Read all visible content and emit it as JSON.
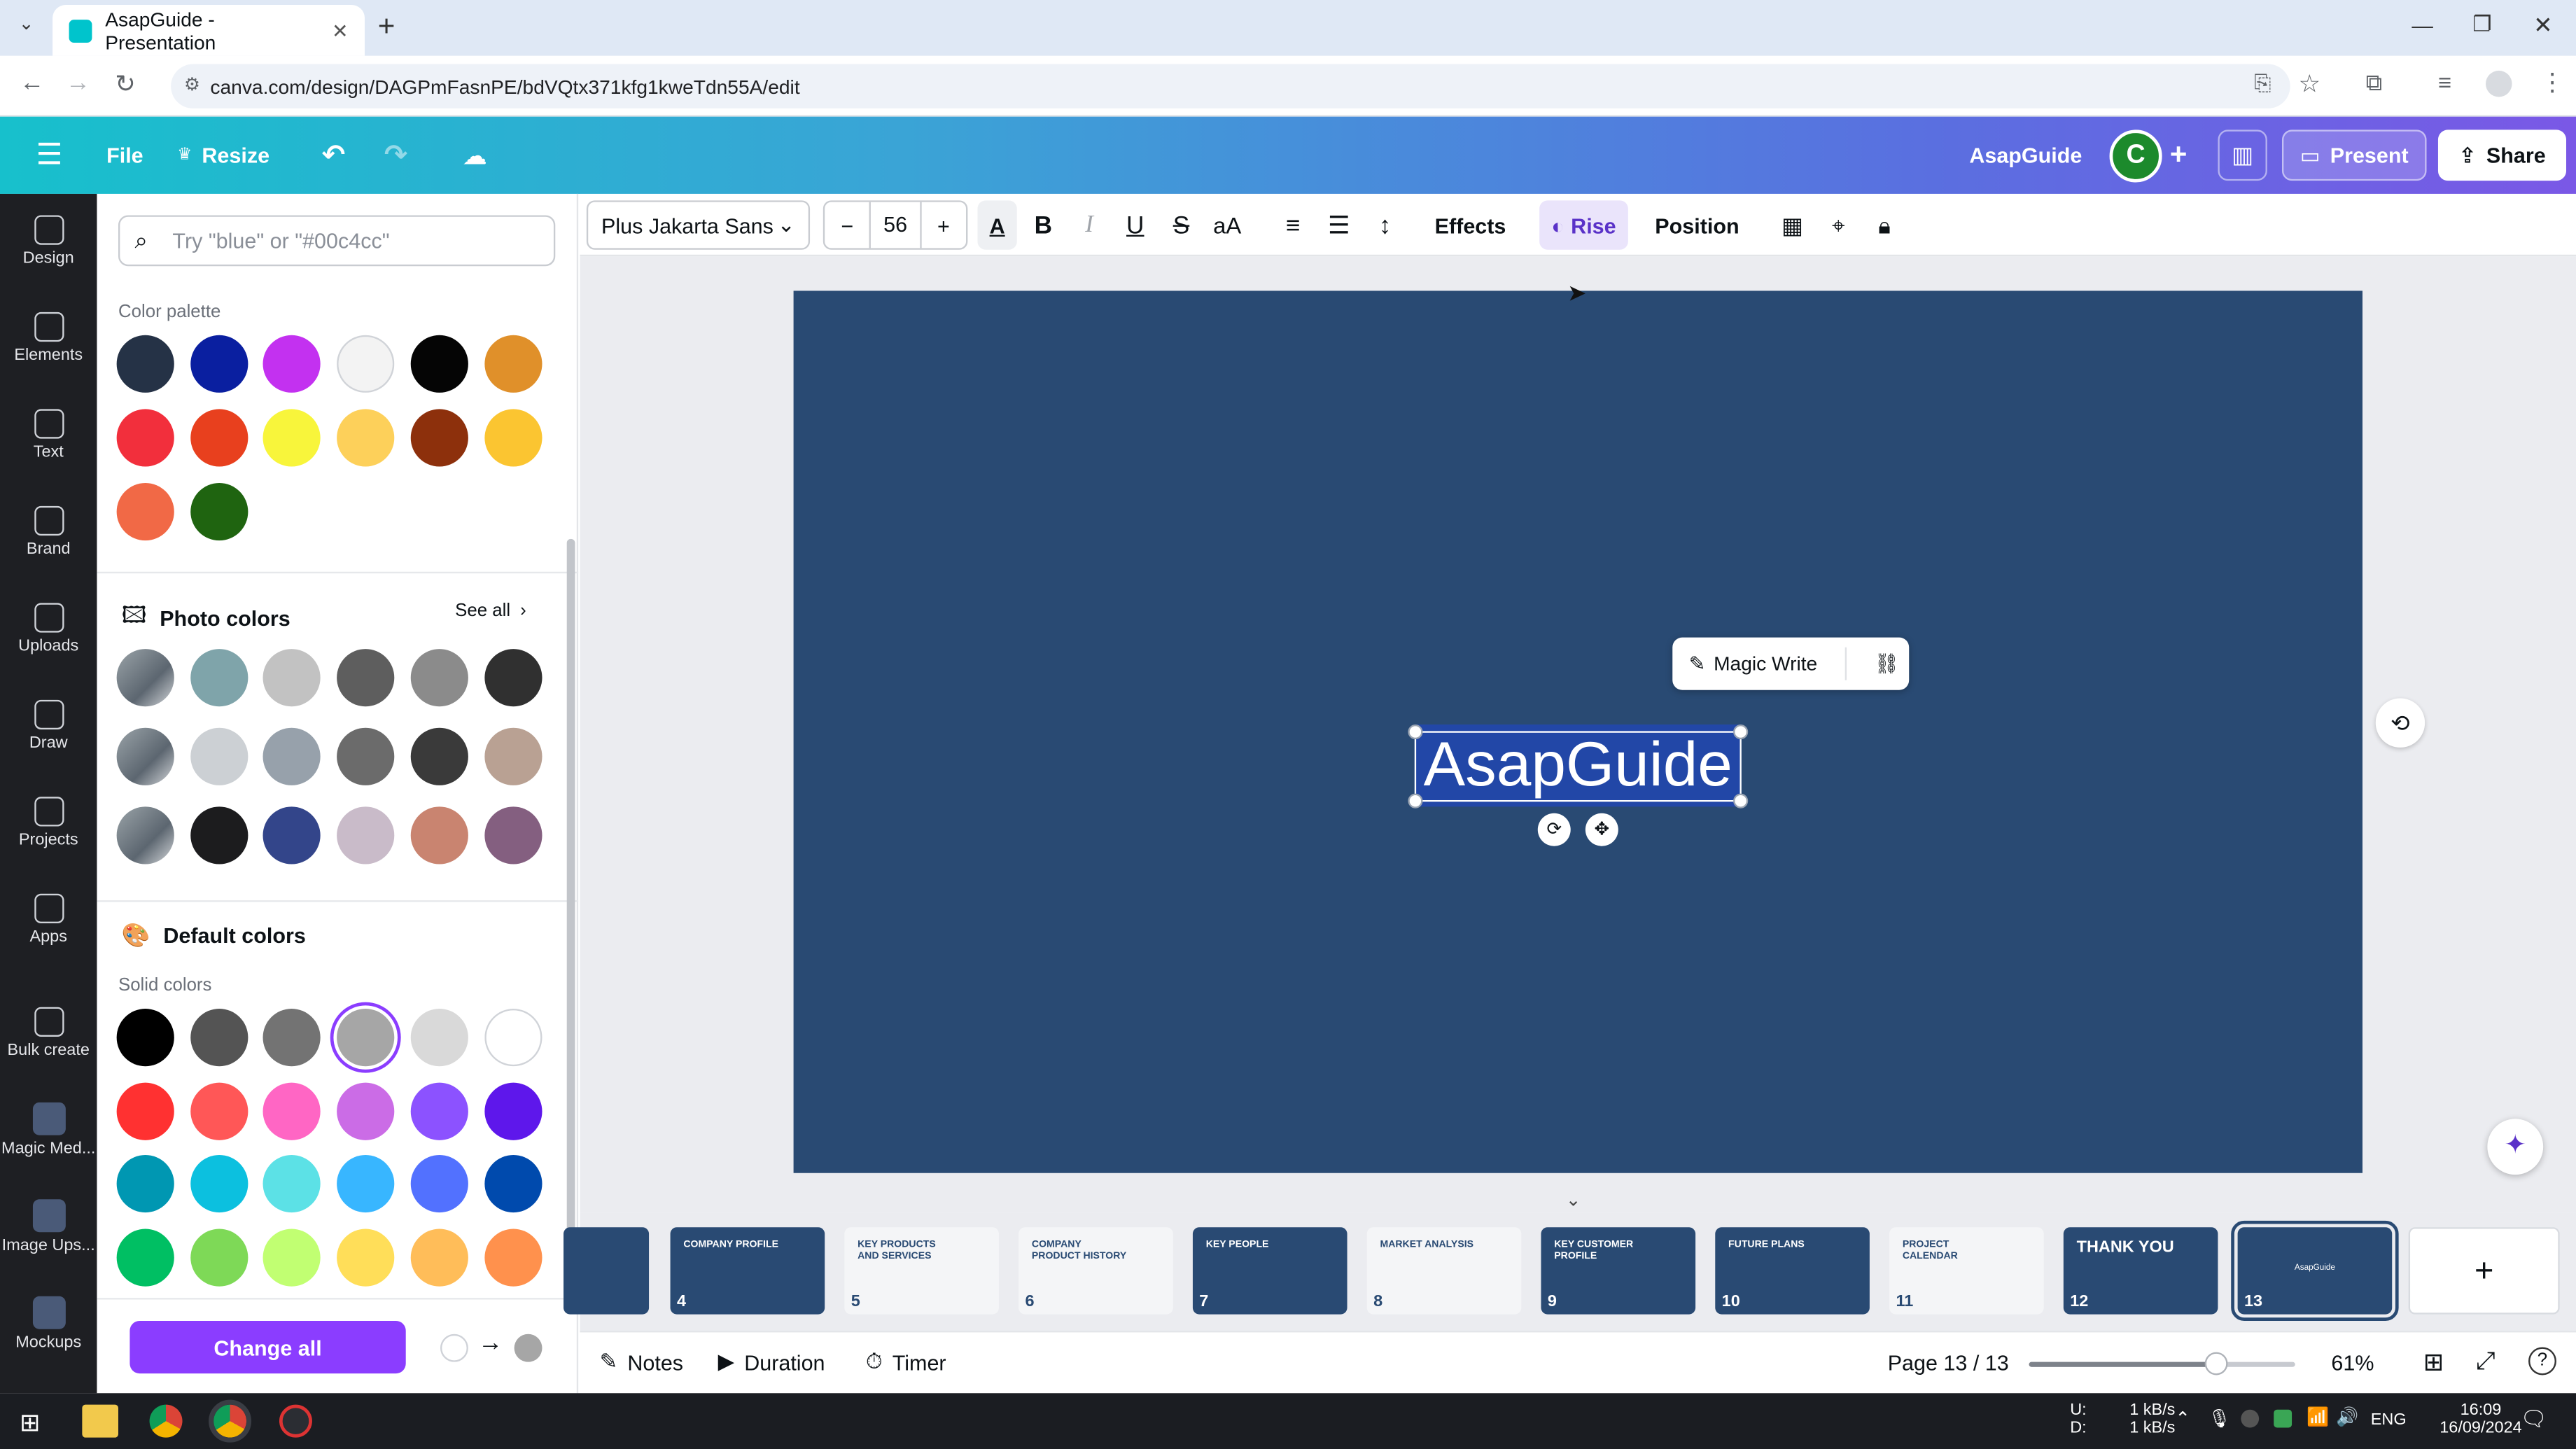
{
  "browser": {
    "tab_title": "AsapGuide - Presentation",
    "url": "canva.com/design/DAGPmFasnPE/bdVQtx371kfg1kweTdn55A/edit"
  },
  "header": {
    "file": "File",
    "resize": "Resize",
    "project_name": "AsapGuide",
    "avatar_initial": "C",
    "present": "Present",
    "share": "Share"
  },
  "rail": [
    {
      "label": "Design",
      "icon": "design-icon"
    },
    {
      "label": "Elements",
      "icon": "elements-icon"
    },
    {
      "label": "Text",
      "icon": "text-icon"
    },
    {
      "label": "Brand",
      "icon": "brand-icon"
    },
    {
      "label": "Uploads",
      "icon": "uploads-icon"
    },
    {
      "label": "Draw",
      "icon": "draw-icon"
    },
    {
      "label": "Projects",
      "icon": "projects-icon"
    },
    {
      "label": "Apps",
      "icon": "apps-icon"
    },
    {
      "label": "Bulk create",
      "icon": "bulk-create-icon"
    },
    {
      "label": "Magic Med...",
      "icon": "magic-media-icon"
    },
    {
      "label": "Image Ups...",
      "icon": "image-upscaler-icon"
    },
    {
      "label": "Mockups",
      "icon": "mockups-icon"
    }
  ],
  "panel": {
    "search_placeholder": "Try \"blue\" or \"#00c4cc\"",
    "color_palette_label": "Color palette",
    "palette": [
      "#253246",
      "#0a1fa0",
      "#c331f0",
      "#f3f3f3",
      "#050505",
      "#e0902a",
      "#f22f3c",
      "#e8401e",
      "#f8f53b",
      "#fdd05a",
      "#8d300c",
      "#fbc531",
      "#f16946",
      "#1f6410"
    ],
    "photo_colors_title": "Photo colors",
    "see_all": "See all",
    "photo_colors": [
      "photo",
      "#7fa4aa",
      "#c2c2c2",
      "#5e5e5e",
      "#8b8b8b",
      "#303030",
      "photo",
      "#ccd0d4",
      "#97a1ab",
      "#6b6b6b",
      "#3a3a3a",
      "#b9a193",
      "photo",
      "#1c1c1e",
      "#33458a",
      "#c9bbc9",
      "#c98470",
      "#845f80"
    ],
    "default_colors_title": "Default colors",
    "solid_colors_label": "Solid colors",
    "solid_colors": [
      "#000000",
      "#545454",
      "#737373",
      "#a6a6a6",
      "#d9d9d9",
      "#ffffff",
      "#ff3131",
      "#ff5757",
      "#ff66c4",
      "#cb6ce6",
      "#8c52ff",
      "#5e17eb",
      "#0097b2",
      "#0cc0df",
      "#5ce1e6",
      "#38b6ff",
      "#5271ff",
      "#004aad",
      "#00bf63",
      "#7ed957",
      "#c1ff72",
      "#ffde59",
      "#ffbd59",
      "#ff914d"
    ],
    "change_all": "Change all"
  },
  "toolbar": {
    "font": "Plus Jakarta Sans",
    "size": "56",
    "effects": "Effects",
    "animate": "Rise",
    "position": "Position"
  },
  "canvas": {
    "magic_write": "Magic Write",
    "selected_text": "AsapGuide",
    "slide_bg": "#294a73"
  },
  "filmstrip": [
    {
      "num": "",
      "title": ""
    },
    {
      "num": "4",
      "title": "COMPANY PROFILE"
    },
    {
      "num": "5",
      "title": "KEY PRODUCTS AND SERVICES"
    },
    {
      "num": "6",
      "title": "COMPANY PRODUCT HISTORY"
    },
    {
      "num": "7",
      "title": "KEY PEOPLE"
    },
    {
      "num": "8",
      "title": "MARKET ANALYSIS"
    },
    {
      "num": "9",
      "title": "KEY CUSTOMER PROFILE"
    },
    {
      "num": "10",
      "title": "FUTURE PLANS"
    },
    {
      "num": "11",
      "title": "PROJECT CALENDAR"
    },
    {
      "num": "12",
      "title": "THANK YOU"
    },
    {
      "num": "13",
      "title": "AsapGuide"
    }
  ],
  "footer": {
    "notes": "Notes",
    "duration": "Duration",
    "timer": "Timer",
    "page": "Page 13 / 13",
    "zoom": "61%",
    "zoom_fraction": 0.61
  },
  "taskbar": {
    "net_up_label": "U:",
    "net_down_label": "D:",
    "net_up": "1 kB/s",
    "net_down": "1 kB/s",
    "lang": "ENG",
    "time": "16:09",
    "date": "16/09/2024"
  }
}
